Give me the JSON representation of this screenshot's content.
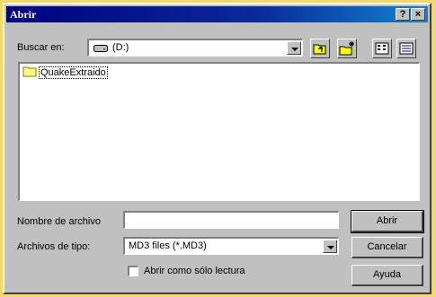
{
  "window": {
    "title": "Abrir",
    "help_label": "?",
    "close_label": "×"
  },
  "lookin": {
    "label": "Buscar en:",
    "value": "(D:)",
    "drive_icon": "drive-icon"
  },
  "toolbar": {
    "icons": [
      "up-one-level-icon",
      "create-new-folder-icon",
      "list-view-icon",
      "details-view-icon"
    ]
  },
  "files": [
    {
      "name": "QuakeExtraido",
      "icon": "folder-icon"
    }
  ],
  "filename": {
    "label": "Nombre de archivo",
    "value": ""
  },
  "filetype": {
    "label": "Archivos de tipo:",
    "value": "MD3 files (*.MD3)"
  },
  "readonly": {
    "label": "Abrir como sólo lectura",
    "checked": false
  },
  "buttons": {
    "open": "Abrir",
    "cancel": "Cancelar",
    "help": "Ayuda"
  },
  "colors": {
    "titlebar": "#000080",
    "face": "#c0c0c0",
    "background": "#f2d96a"
  }
}
